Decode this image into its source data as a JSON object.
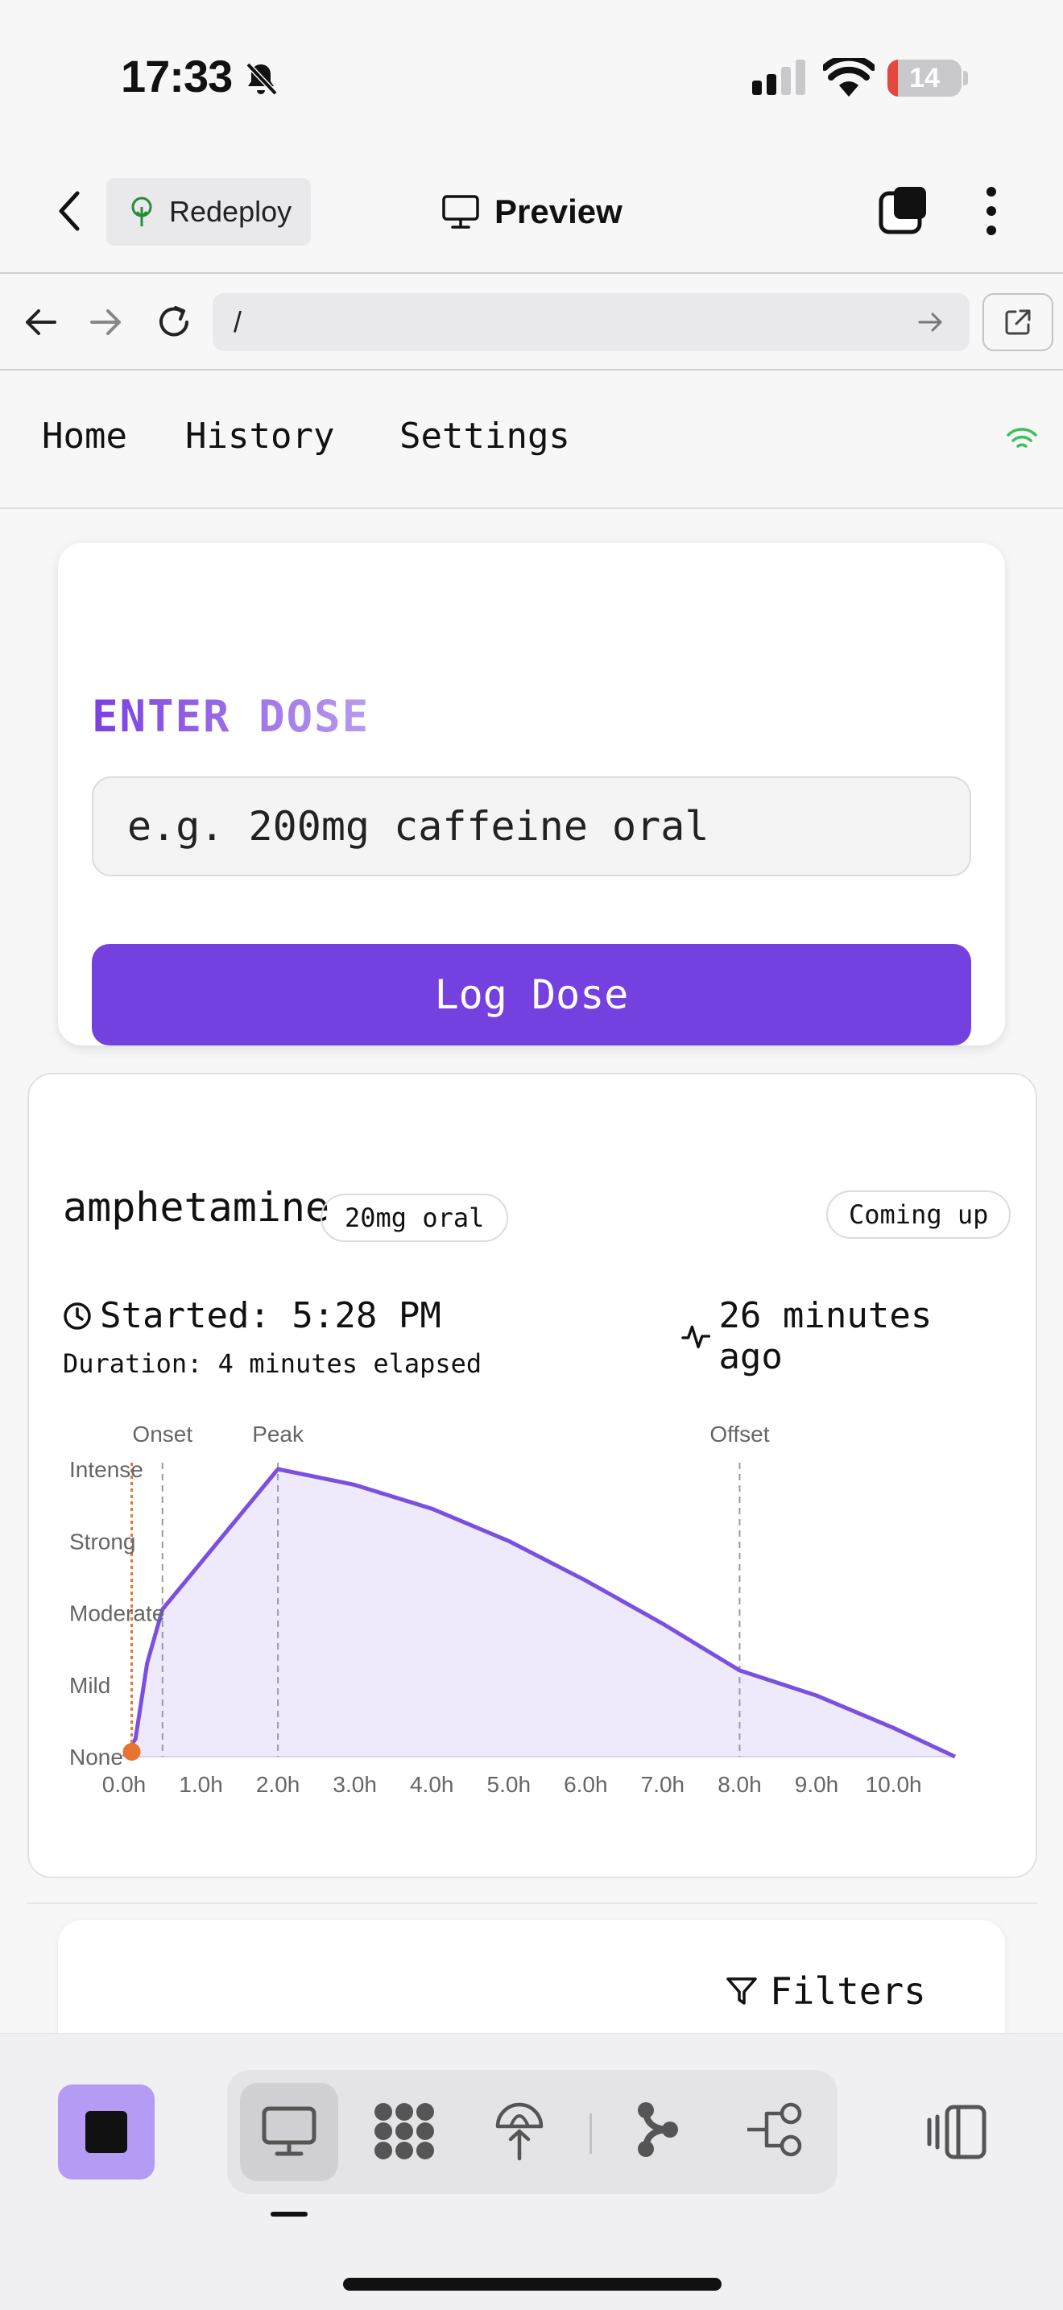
{
  "status_bar": {
    "time": "17:33",
    "battery_level": "14",
    "battery_fraction": 0.14,
    "icons": [
      "bell-slash-icon",
      "cellular-signal-icon",
      "wifi-icon",
      "battery-icon"
    ]
  },
  "app_header": {
    "back_icon": "chevron-left-icon",
    "redeploy_label": "Redeploy",
    "preview_label": "Preview",
    "tabs_icon": "tabs-icon",
    "more_icon": "more-vertical-icon"
  },
  "browser_bar": {
    "url": "/",
    "icons": [
      "arrow-left-icon",
      "arrow-right-icon",
      "reload-icon",
      "go-arrow-icon",
      "external-link-icon"
    ]
  },
  "nav": {
    "items": [
      {
        "label": "Home"
      },
      {
        "label": "History"
      },
      {
        "label": "Settings"
      }
    ],
    "connection_icon": "wifi-icon",
    "connection_color": "#3fbf5a"
  },
  "dose_form": {
    "title": "ENTER DOSE",
    "input_placeholder": "e.g. 200mg caffeine oral",
    "button_label": "Log Dose",
    "accent_color": "#7540e0"
  },
  "dose_entry": {
    "substance": "amphetamine",
    "dose": "20mg oral",
    "phase": "Coming up",
    "started": "Started: 5:28 PM",
    "ago": "26 minutes ago",
    "duration": "Duration: 4 minutes elapsed"
  },
  "next_card": {
    "filters_label": "Filters"
  },
  "chart_data": {
    "type": "area",
    "title": "",
    "xlabel": "",
    "ylabel": "",
    "x_ticks": [
      "0.0h",
      "1.0h",
      "2.0h",
      "3.0h",
      "4.0h",
      "5.0h",
      "6.0h",
      "7.0h",
      "8.0h",
      "9.0h",
      "10.0h"
    ],
    "y_ticks": [
      "None",
      "Mild",
      "Moderate",
      "Strong",
      "Intense"
    ],
    "xlim": [
      0,
      10.8
    ],
    "ylim": [
      0,
      4
    ],
    "series": [
      {
        "x": [
          0,
          0.15,
          0.3,
          0.5,
          2.0,
          3.0,
          4.0,
          5.0,
          6.0,
          7.0,
          8.0,
          9.0,
          10.0,
          10.8
        ],
        "y": [
          0,
          0.25,
          1.3,
          2.05,
          4.0,
          3.78,
          3.45,
          3.0,
          2.45,
          1.85,
          1.2,
          0.85,
          0.4,
          0.0
        ]
      }
    ],
    "markers": [
      {
        "label": "Onset",
        "x": 0.5
      },
      {
        "label": "Peak",
        "x": 2.0
      },
      {
        "label": "Offset",
        "x": 8.0
      }
    ],
    "current_time": 0.1,
    "line_color": "#7b4fe0",
    "fill_color": "#efeafb",
    "now_color": "#e8742f",
    "grid": false
  },
  "toolbar": {
    "stop_icon": "stop-icon",
    "segments": [
      "desktop-preview-icon",
      "grid-dots-icon",
      "deploy-icon",
      "branch-icon",
      "flow-icon"
    ],
    "panel_icon": "sidebar-toggle-icon"
  }
}
